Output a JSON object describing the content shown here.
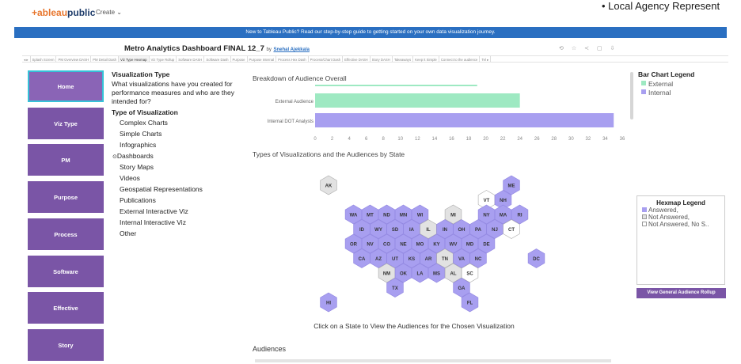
{
  "header": {
    "logo_text": "+ableau",
    "logo_public": "public",
    "create_label": "Create ⌄",
    "bullet_text": "•  Local Agency Represent"
  },
  "banner": {
    "text": "New to Tableau Public? Read our step-by-step guide to getting started on your own data visualization journey."
  },
  "dashboard": {
    "title": "Metro Analytics Dashboard FINAL 12_7",
    "by": "by",
    "author": "Snehal Ajekkala",
    "toolbar_icons": [
      "history-icon",
      "star-icon",
      "share-icon",
      "comment-icon",
      "download-icon"
    ]
  },
  "tabs": [
    "◂ ▸",
    "Splash Screen",
    "PM Overview DASH",
    "PM Detail Dash",
    "Viz Type Hexmap",
    "Viz Type Rollup",
    "Software DASH",
    "Software Dash",
    "Purpose",
    "Purpose Internal",
    "Process Hex Dash",
    "Process/Chart Dash",
    "Effective DASH",
    "Story DASH",
    "Takeaways",
    "Keep it Simple",
    "Connect to the audience",
    "Tel ▸"
  ],
  "active_tab_index": 4,
  "nav": {
    "items": [
      "Home",
      "Viz Type",
      "PM",
      "Purpose",
      "Process",
      "Software",
      "Effective",
      "Story"
    ]
  },
  "viz_type": {
    "title": "Visualization Type",
    "description": "What visualizations have you created for performance measures and who are they intended for?",
    "filter_title": "Type of Visualization",
    "options": [
      "Complex Charts",
      "Simple Charts",
      "Infographics",
      "Dashboards",
      "Story Maps",
      "Videos",
      "Geospatial Representations",
      "Publications",
      "External Interactive Viz",
      "Internal Interactive Viz",
      "Other"
    ],
    "selected": "Dashboards"
  },
  "bar_section": {
    "title": "Breakdown of Audience Overall"
  },
  "chart_data": {
    "type": "bar",
    "orientation": "horizontal",
    "categories": [
      "External Audience",
      "Internal DOT Analysts"
    ],
    "values": [
      24,
      35
    ],
    "colors": [
      "#9ee9c2",
      "#a89ff0"
    ],
    "xlim": [
      0,
      36
    ],
    "xticks": [
      0,
      2,
      4,
      6,
      8,
      10,
      12,
      14,
      16,
      18,
      20,
      22,
      24,
      26,
      28,
      30,
      32,
      34,
      36
    ]
  },
  "bar_legend": {
    "title": "Bar Chart Legend",
    "items": [
      {
        "label": "External",
        "color": "#9ee9c2"
      },
      {
        "label": "Internal",
        "color": "#a89ff0"
      }
    ]
  },
  "hexmap": {
    "title": "Types of Visualizations and the Audiences by State",
    "answered_color": "#a89ff0",
    "not_answered_color": "#e2e2e2",
    "not_answered_no_s_color": "#ffffff",
    "states": [
      {
        "abbr": "AK",
        "status": "not_answered"
      },
      {
        "abbr": "ME",
        "status": "answered"
      },
      {
        "abbr": "VT",
        "status": "no_s"
      },
      {
        "abbr": "NH",
        "status": "answered"
      },
      {
        "abbr": "WA",
        "status": "answered"
      },
      {
        "abbr": "MT",
        "status": "answered"
      },
      {
        "abbr": "ND",
        "status": "answered"
      },
      {
        "abbr": "MN",
        "status": "answered"
      },
      {
        "abbr": "WI",
        "status": "answered"
      },
      {
        "abbr": "MI",
        "status": "not_answered"
      },
      {
        "abbr": "NY",
        "status": "answered"
      },
      {
        "abbr": "MA",
        "status": "answered"
      },
      {
        "abbr": "RI",
        "status": "answered"
      },
      {
        "abbr": "ID",
        "status": "answered"
      },
      {
        "abbr": "WY",
        "status": "answered"
      },
      {
        "abbr": "SD",
        "status": "answered"
      },
      {
        "abbr": "IA",
        "status": "answered"
      },
      {
        "abbr": "IL",
        "status": "not_answered"
      },
      {
        "abbr": "IN",
        "status": "answered"
      },
      {
        "abbr": "OH",
        "status": "answered"
      },
      {
        "abbr": "PA",
        "status": "answered"
      },
      {
        "abbr": "NJ",
        "status": "answered"
      },
      {
        "abbr": "CT",
        "status": "no_s"
      },
      {
        "abbr": "OR",
        "status": "answered"
      },
      {
        "abbr": "NV",
        "status": "answered"
      },
      {
        "abbr": "CO",
        "status": "answered"
      },
      {
        "abbr": "NE",
        "status": "answered"
      },
      {
        "abbr": "MO",
        "status": "answered"
      },
      {
        "abbr": "KY",
        "status": "answered"
      },
      {
        "abbr": "WV",
        "status": "answered"
      },
      {
        "abbr": "MD",
        "status": "answered"
      },
      {
        "abbr": "DE",
        "status": "answered"
      },
      {
        "abbr": "CA",
        "status": "answered"
      },
      {
        "abbr": "AZ",
        "status": "answered"
      },
      {
        "abbr": "UT",
        "status": "answered"
      },
      {
        "abbr": "KS",
        "status": "answered"
      },
      {
        "abbr": "AR",
        "status": "answered"
      },
      {
        "abbr": "TN",
        "status": "not_answered"
      },
      {
        "abbr": "VA",
        "status": "answered"
      },
      {
        "abbr": "NC",
        "status": "answered"
      },
      {
        "abbr": "DC",
        "status": "answered"
      },
      {
        "abbr": "NM",
        "status": "not_answered"
      },
      {
        "abbr": "OK",
        "status": "answered"
      },
      {
        "abbr": "LA",
        "status": "answered"
      },
      {
        "abbr": "MS",
        "status": "answered"
      },
      {
        "abbr": "AL",
        "status": "not_answered"
      },
      {
        "abbr": "SC",
        "status": "no_s"
      },
      {
        "abbr": "TX",
        "status": "answered"
      },
      {
        "abbr": "GA",
        "status": "answered"
      },
      {
        "abbr": "HI",
        "status": "answered"
      },
      {
        "abbr": "FL",
        "status": "answered"
      }
    ],
    "click_note": "Click on a State to View the Audiences for the Chosen Visualization"
  },
  "hex_legend": {
    "title": "Hexmap Legend",
    "items": [
      "Answered,",
      "Not Answered,",
      "Not Answered, No S.."
    ]
  },
  "rollup_button": "View General Audience Rollup",
  "audiences_title": "Audiences"
}
